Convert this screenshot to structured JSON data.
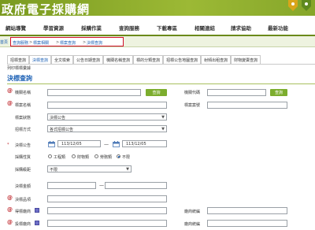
{
  "site": {
    "title": "政府電子採購網"
  },
  "nav": {
    "items": [
      "網站導覽",
      "學習資源",
      "採購作業",
      "查詢服務",
      "下載專區",
      "相關連結",
      "請求協助",
      "最新功能"
    ]
  },
  "breadcrumb": {
    "home": "首頁",
    "path": [
      "查詢服務",
      "標案相關",
      "標案查詢",
      "決標查詢"
    ]
  },
  "tabs": {
    "row1": [
      "招標查詢",
      "決標查詢",
      "全文檢索",
      "公告日期查詢",
      "機關名稱查詢",
      "標的分類查詢",
      "招標公告地圖查詢",
      "射頻出租查詢",
      "財物變賣查詢"
    ],
    "row2": [
      "列印標標彙據"
    ],
    "active": "決標查詢"
  },
  "section": {
    "title": "決標查詢"
  },
  "form": {
    "agency_name": {
      "label": "機關名稱",
      "value": ""
    },
    "agency_code": {
      "label": "機關代碼",
      "value": ""
    },
    "tender_name": {
      "label": "標案名稱",
      "value": ""
    },
    "tender_no": {
      "label": "標案案號",
      "value": ""
    },
    "tender_status": {
      "label": "標案狀態",
      "value": "決標公告"
    },
    "method": {
      "label": "招標方式",
      "value": "各式招標公告"
    },
    "announce": {
      "label": "決標公告",
      "date_from": "113/12/05",
      "date_to": "113/12/05",
      "dash": "—"
    },
    "nature": {
      "label": "採購性質",
      "options": [
        "工程類",
        "財物類",
        "勞務類",
        "不限"
      ],
      "selected": "不限"
    },
    "scale": {
      "label": "採購級距",
      "value": "不限"
    },
    "amount": {
      "label": "決標金額",
      "dash": "—"
    },
    "item": {
      "label": "決標品項"
    },
    "winner": {
      "label": "得標廠商",
      "country_label": "廠商統編"
    },
    "bidder": {
      "label": "投標廠商",
      "country_label": "廠商統編"
    },
    "search_button": "查詢"
  },
  "colors": {
    "brand": "#8bb02c",
    "link": "#1a5fb4",
    "required": "#c0282d",
    "button": "#7cad2e"
  }
}
